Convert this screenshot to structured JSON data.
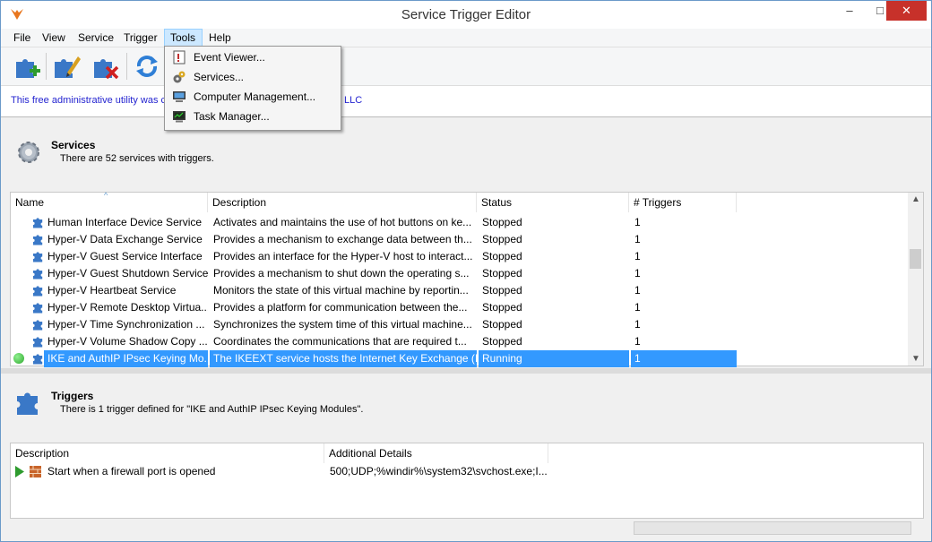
{
  "window": {
    "title": "Service Trigger Editor",
    "minimize": "–",
    "maximize": "□",
    "close": "✕"
  },
  "menu": [
    "File",
    "View",
    "Service",
    "Trigger",
    "Tools",
    "Help"
  ],
  "toolbar_icons": [
    "add-service-icon",
    "edit-service-icon",
    "delete-service-icon",
    "refresh-icon"
  ],
  "info_banner": {
    "left": "This free administrative utility was c",
    "right": "LLC"
  },
  "tools_menu": [
    {
      "label": "Event Viewer...",
      "icon": "event-viewer-icon"
    },
    {
      "label": "Services...",
      "icon": "services-icon"
    },
    {
      "label": "Computer Management...",
      "icon": "computer-management-icon"
    },
    {
      "label": "Task Manager...",
      "icon": "task-manager-icon"
    }
  ],
  "services": {
    "title": "Services",
    "subtitle": "There are 52 services with triggers.",
    "columns": [
      "Name",
      "Description",
      "Status",
      "# Triggers"
    ],
    "rows": [
      {
        "name": "Human Interface Device Service",
        "desc": "Activates and maintains the use of hot buttons on ke...",
        "status": "Stopped",
        "triggers": "1"
      },
      {
        "name": "Hyper-V Data Exchange Service",
        "desc": "Provides a mechanism to exchange data between th...",
        "status": "Stopped",
        "triggers": "1"
      },
      {
        "name": "Hyper-V Guest Service Interface",
        "desc": "Provides an interface for the Hyper-V host to interact...",
        "status": "Stopped",
        "triggers": "1"
      },
      {
        "name": "Hyper-V Guest Shutdown Service",
        "desc": "Provides a mechanism to shut down the operating s...",
        "status": "Stopped",
        "triggers": "1"
      },
      {
        "name": "Hyper-V Heartbeat Service",
        "desc": "Monitors the state of this virtual machine by reportin...",
        "status": "Stopped",
        "triggers": "1"
      },
      {
        "name": "Hyper-V Remote Desktop Virtua...",
        "desc": "Provides a platform for communication between the...",
        "status": "Stopped",
        "triggers": "1"
      },
      {
        "name": "Hyper-V Time Synchronization ...",
        "desc": "Synchronizes the system time of this virtual machine...",
        "status": "Stopped",
        "triggers": "1"
      },
      {
        "name": "Hyper-V Volume Shadow Copy ...",
        "desc": "Coordinates the communications that are required t...",
        "status": "Stopped",
        "triggers": "1"
      },
      {
        "name": "IKE and AuthIP IPsec Keying Mo...",
        "desc": "The IKEEXT service hosts the Internet Key Exchange (I...",
        "status": "Running",
        "triggers": "1",
        "selected": true
      }
    ]
  },
  "triggers": {
    "title": "Triggers",
    "subtitle": "There is 1 trigger defined for \"IKE and AuthIP IPsec Keying Modules\".",
    "columns": [
      "Description",
      "Additional Details"
    ],
    "rows": [
      {
        "desc": "Start when a firewall port is opened",
        "details": "500;UDP;%windir%\\system32\\svchost.exe;I..."
      }
    ]
  },
  "colors": {
    "selection": "#3399ff",
    "running": "#2fa82f",
    "link": "#2424d0"
  }
}
